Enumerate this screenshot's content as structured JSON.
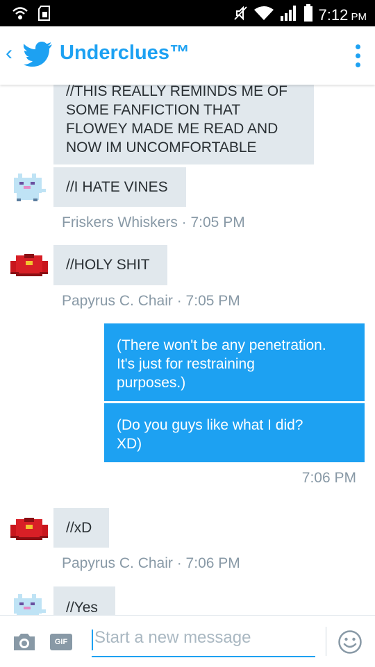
{
  "status": {
    "time": "7:12",
    "ampm": "PM",
    "icons": [
      "phone-wifi-icon",
      "sd-card-icon",
      "mute-icon",
      "wifi-icon",
      "signal-icon",
      "battery-icon"
    ]
  },
  "header": {
    "back_label": "‹",
    "title": "Underclues™",
    "accent": "#1da1f2"
  },
  "messages": [
    {
      "text": "//THIS REALLY REMINDS ME OF\nSOME FANFICTION THAT\nFLOWEY MADE ME READ AND\nNOW IM UNCOMFORTABLE"
    },
    {
      "text": "//I HATE VINES",
      "avatar": "cat-avatar"
    },
    {
      "meta": "Friskers Whiskers · 7:05 PM"
    },
    {
      "text": "//HOLY SHIT",
      "avatar": "sweater-avatar"
    },
    {
      "meta": "Papyrus C. Chair · 7:05 PM"
    },
    {
      "text": "(There won't be any penetration.\nIt's just for restraining\npurposes.)"
    },
    {
      "text": "(Do you guys like what I did?\nXD)"
    },
    {
      "meta": "7:06 PM"
    },
    {
      "text": "//xD",
      "avatar": "sweater-avatar"
    },
    {
      "meta": "Papyrus C. Chair · 7:06 PM"
    },
    {
      "text": "//Yes",
      "avatar": "cat-avatar"
    }
  ],
  "composer": {
    "placeholder": "Start a new message",
    "gif_label": "GIF"
  },
  "colors": {
    "incoming_bubble": "#e1e8ed",
    "outgoing_bubble": "#1da1f2",
    "meta_text": "#8899a6"
  }
}
